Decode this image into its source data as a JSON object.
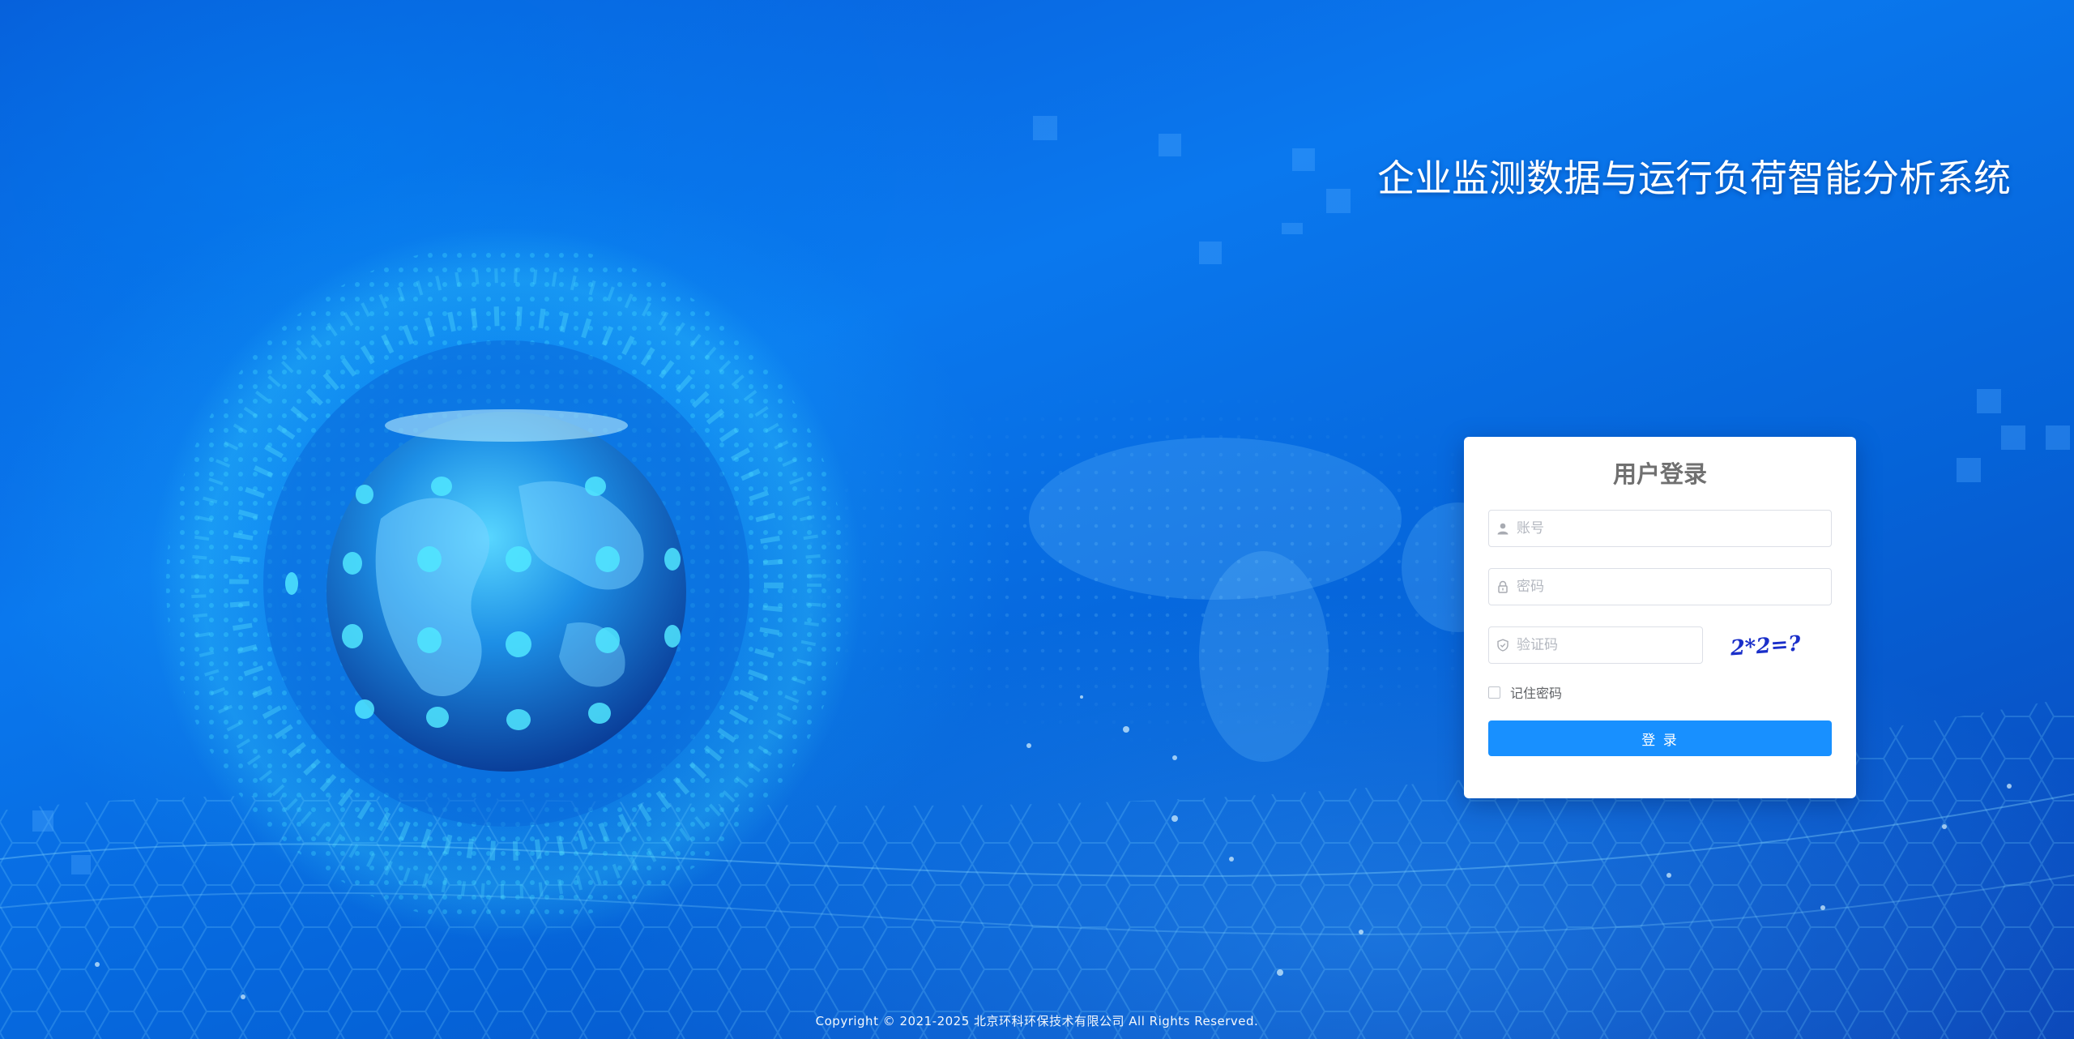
{
  "header": {
    "system_title": "企业监测数据与运行负荷智能分析系统"
  },
  "login": {
    "title": "用户登录",
    "username_placeholder": "账号",
    "username_value": "",
    "password_placeholder": "密码",
    "password_value": "",
    "captcha_placeholder": "验证码",
    "captcha_value": "",
    "captcha_image_text": "2*2=?",
    "remember_label": "记住密码",
    "remember_checked": false,
    "submit_label": "登 录"
  },
  "icons": {
    "username": "user-icon",
    "password": "lock-icon",
    "captcha": "shield-icon"
  },
  "colors": {
    "primary_button": "#1890ff",
    "background_blue": "#0a78ee",
    "title_text": "#ffffff",
    "card_title": "#707070"
  },
  "footer": {
    "copyright": "Copyright © 2021-2025 北京环科环保技术有限公司 All Rights Reserved."
  }
}
